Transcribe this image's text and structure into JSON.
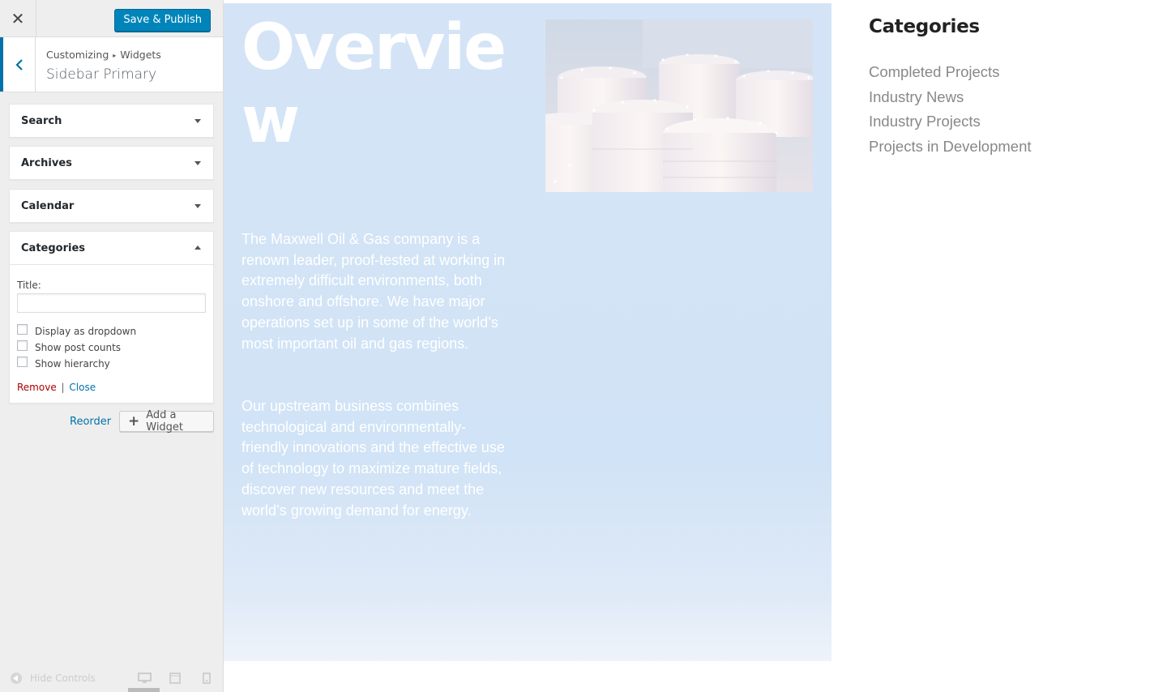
{
  "topbar": {
    "close_icon": "close-icon",
    "save_label": "Save & Publish",
    "accent_color": "#0085ba"
  },
  "panel": {
    "back_icon": "chevron-left-icon",
    "breadcrumb_root": "Customizing",
    "breadcrumb_sep": "▸",
    "breadcrumb_section": "Widgets",
    "title": "Sidebar Primary"
  },
  "widgets": [
    {
      "label": "Search",
      "expanded": false
    },
    {
      "label": "Archives",
      "expanded": false
    },
    {
      "label": "Calendar",
      "expanded": false
    },
    {
      "label": "Categories",
      "expanded": true
    }
  ],
  "categories_form": {
    "title_label": "Title:",
    "title_value": "",
    "options": [
      {
        "label": "Display as dropdown",
        "checked": false
      },
      {
        "label": "Show post counts",
        "checked": false
      },
      {
        "label": "Show hierarchy",
        "checked": false
      }
    ],
    "remove_label": "Remove",
    "pipe": "|",
    "close_label": "Close"
  },
  "widget_actions": {
    "reorder_label": "Reorder",
    "add_label": "Add a Widget"
  },
  "footer": {
    "hide_controls_label": "Hide Controls",
    "devices": [
      "desktop-icon",
      "tablet-icon",
      "mobile-icon"
    ],
    "active_device": "desktop"
  },
  "preview": {
    "hero_title": "Overview",
    "hero_paragraph_1": "The Maxwell Oil & Gas company is a renown leader, proof-tested at working in extremely difficult environments, both onshore and offshore. We have major operations set up in some of the world’s most important oil and gas regions.",
    "hero_paragraph_2": "Our upstream business combines technological and environmentally-friendly innovations and the effective use of technology to maximize mature fields, discover new resources and meet the world’s growing demand for energy.",
    "hero_image": "oil-storage-tanks-image",
    "categories_heading": "Categories",
    "categories": [
      "Completed Projects",
      "Industry News",
      "Industry Projects",
      "Projects in Development"
    ]
  }
}
